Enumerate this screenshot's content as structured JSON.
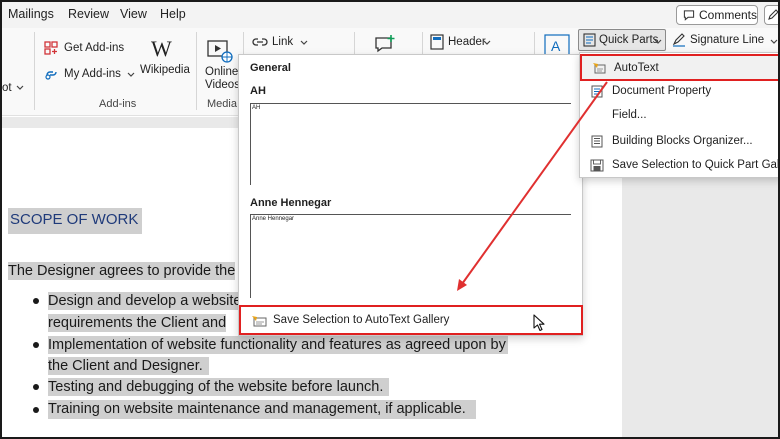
{
  "menubar": {
    "tabs": [
      "Mailings",
      "Review",
      "View",
      "Help"
    ],
    "comments_label": "Comments"
  },
  "ribbon": {
    "get_addins": "Get Add-ins",
    "my_addins": "My Add-ins",
    "wikipedia": "Wikipedia",
    "online_1": "Online",
    "online_2": "Videos",
    "link": "Link",
    "header": "Header",
    "quick_parts": "Quick Parts",
    "signature_line": "Signature Line",
    "left_cut": "ot",
    "addins_group": "Add-ins",
    "media_group": "Media"
  },
  "autotext_panel": {
    "heading": "General",
    "entries": [
      {
        "name": "AH",
        "preview": "AH"
      },
      {
        "name": "Anne Hennegar",
        "preview": "Anne Hennegar"
      }
    ],
    "save_label": "Save Selection to AutoText Gallery"
  },
  "quick_parts_menu": {
    "items": [
      "AutoText",
      "Document Property",
      "Field...",
      "Building Blocks Organizer...",
      "Save Selection to Quick Part Gallery..."
    ]
  },
  "document": {
    "heading": "SCOPE OF WORK",
    "intro": "The Designer agrees to provide the",
    "bullets": [
      {
        "line1": "Design and develop a website",
        "line2": "requirements the Client and"
      },
      {
        "line1": "Implementation of website functionality and features as agreed upon by",
        "line2": "the Client and Designer."
      },
      {
        "line1": "Testing and debugging of the website before launch.",
        "line2": ""
      },
      {
        "line1": "Training on website maintenance and management, if applicable.",
        "line2": ""
      }
    ]
  },
  "colors": {
    "highlight_box": "#e02020",
    "arrow": "#e03030",
    "heading_text": "#1f3a7a",
    "selection": "#cfcfcf"
  }
}
